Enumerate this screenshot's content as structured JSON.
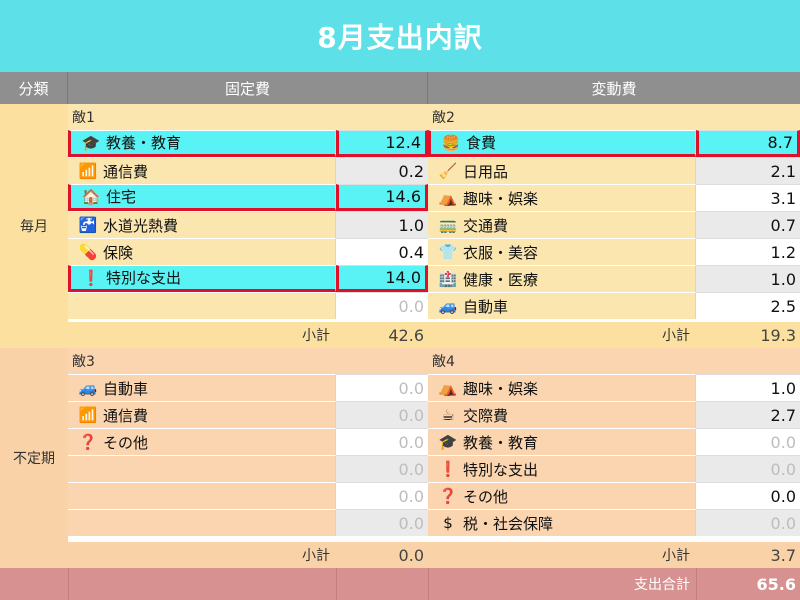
{
  "title": "8月支出内訳",
  "headers": {
    "category": "分類",
    "fixed": "固定費",
    "variable": "変動費"
  },
  "rows": {
    "monthly": "毎月",
    "irregular": "不定期"
  },
  "sections": {
    "s1": "敵1",
    "s2": "敵2",
    "s3": "敵3",
    "s4": "敵4"
  },
  "s1_items": [
    {
      "icon": "graduation-cap-icon",
      "glyph": "🎓",
      "name": "教養・教育",
      "value": "12.4"
    },
    {
      "icon": "wifi-icon",
      "glyph": "📶",
      "name": "通信費",
      "value": "0.2"
    },
    {
      "icon": "house-icon",
      "glyph": "🏠",
      "name": "住宅",
      "value": "14.6"
    },
    {
      "icon": "faucet-icon",
      "glyph": "🚰",
      "name": "水道光熱費",
      "value": "1.0"
    },
    {
      "icon": "pill-icon",
      "glyph": "💊",
      "name": "保険",
      "value": "0.4"
    },
    {
      "icon": "exclamation-icon",
      "glyph": "❗",
      "name": "特別な支出",
      "value": "14.0"
    },
    {
      "value": "0.0"
    }
  ],
  "s2_items": [
    {
      "icon": "hamburger-icon",
      "glyph": "🍔",
      "name": "食費",
      "value": "8.7"
    },
    {
      "icon": "broom-icon",
      "glyph": "🧹",
      "name": "日用品",
      "value": "2.1"
    },
    {
      "icon": "tent-icon",
      "glyph": "⛺",
      "name": "趣味・娯楽",
      "value": "3.1"
    },
    {
      "icon": "train-icon",
      "glyph": "🚃",
      "name": "交通費",
      "value": "0.7"
    },
    {
      "icon": "shirt-icon",
      "glyph": "👕",
      "name": "衣服・美容",
      "value": "1.2"
    },
    {
      "icon": "hospital-icon",
      "glyph": "🏥",
      "name": "健康・医療",
      "value": "1.0"
    },
    {
      "icon": "car-icon",
      "glyph": "🚙",
      "name": "自動車",
      "value": "2.5"
    }
  ],
  "s3_items": [
    {
      "icon": "car-icon",
      "glyph": "🚙",
      "name": "自動車",
      "value": "0.0"
    },
    {
      "icon": "wifi-icon",
      "glyph": "📶",
      "name": "通信費",
      "value": "0.0"
    },
    {
      "icon": "question-icon",
      "glyph": "❓",
      "name": "その他",
      "value": "0.0"
    },
    {
      "value": "0.0"
    },
    {
      "value": "0.0"
    },
    {
      "value": "0.0"
    }
  ],
  "s4_items": [
    {
      "icon": "tent-icon",
      "glyph": "⛺",
      "name": "趣味・娯楽",
      "value": "1.0"
    },
    {
      "icon": "coffee-icon",
      "glyph": "☕",
      "name": "交際費",
      "value": "2.7"
    },
    {
      "icon": "graduation-cap-icon",
      "glyph": "🎓",
      "name": "教養・教育",
      "value": "0.0"
    },
    {
      "icon": "exclamation-icon",
      "glyph": "❗",
      "name": "特別な支出",
      "value": "0.0"
    },
    {
      "icon": "question-icon",
      "glyph": "❓",
      "name": "その他",
      "value": "0.0"
    },
    {
      "icon": "dollar-icon",
      "glyph": "$",
      "name": "税・社会保障",
      "value": "0.0"
    }
  ],
  "subtotal_label": "小計",
  "subtotals": {
    "s1": "42.6",
    "s2": "19.3",
    "s3": "0.0",
    "s4": "3.7"
  },
  "total_label": "支出合計",
  "total_value": "65.6",
  "colors": {
    "title_bg": "#5ee0e8",
    "header_bg": "#8f8f8f",
    "highlight": "#5af3f5",
    "highlight_border": "#e0102a",
    "monthly_bg": "#fbe6b0",
    "irregular_bg": "#fad5b0",
    "total_bg": "#d79191"
  }
}
